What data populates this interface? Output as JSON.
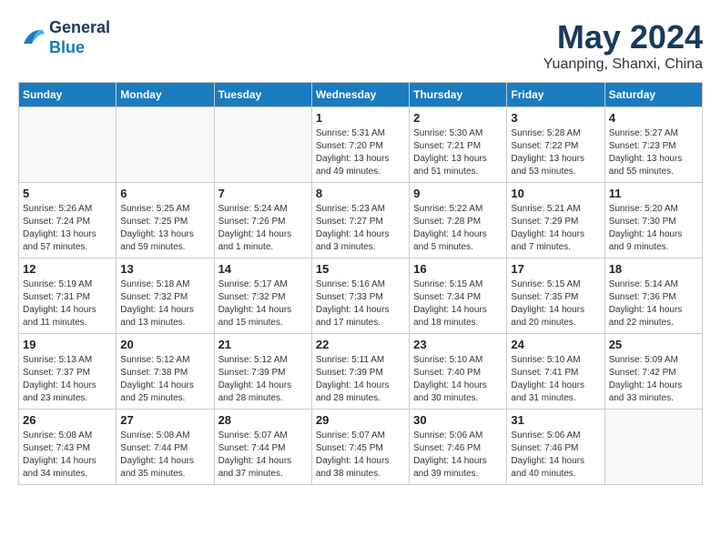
{
  "header": {
    "logo_line1": "General",
    "logo_line2": "Blue",
    "month_year": "May 2024",
    "location": "Yuanping, Shanxi, China"
  },
  "weekdays": [
    "Sunday",
    "Monday",
    "Tuesday",
    "Wednesday",
    "Thursday",
    "Friday",
    "Saturday"
  ],
  "weeks": [
    [
      {
        "day": "",
        "info": ""
      },
      {
        "day": "",
        "info": ""
      },
      {
        "day": "",
        "info": ""
      },
      {
        "day": "1",
        "info": "Sunrise: 5:31 AM\nSunset: 7:20 PM\nDaylight: 13 hours\nand 49 minutes."
      },
      {
        "day": "2",
        "info": "Sunrise: 5:30 AM\nSunset: 7:21 PM\nDaylight: 13 hours\nand 51 minutes."
      },
      {
        "day": "3",
        "info": "Sunrise: 5:28 AM\nSunset: 7:22 PM\nDaylight: 13 hours\nand 53 minutes."
      },
      {
        "day": "4",
        "info": "Sunrise: 5:27 AM\nSunset: 7:23 PM\nDaylight: 13 hours\nand 55 minutes."
      }
    ],
    [
      {
        "day": "5",
        "info": "Sunrise: 5:26 AM\nSunset: 7:24 PM\nDaylight: 13 hours\nand 57 minutes."
      },
      {
        "day": "6",
        "info": "Sunrise: 5:25 AM\nSunset: 7:25 PM\nDaylight: 13 hours\nand 59 minutes."
      },
      {
        "day": "7",
        "info": "Sunrise: 5:24 AM\nSunset: 7:26 PM\nDaylight: 14 hours\nand 1 minute."
      },
      {
        "day": "8",
        "info": "Sunrise: 5:23 AM\nSunset: 7:27 PM\nDaylight: 14 hours\nand 3 minutes."
      },
      {
        "day": "9",
        "info": "Sunrise: 5:22 AM\nSunset: 7:28 PM\nDaylight: 14 hours\nand 5 minutes."
      },
      {
        "day": "10",
        "info": "Sunrise: 5:21 AM\nSunset: 7:29 PM\nDaylight: 14 hours\nand 7 minutes."
      },
      {
        "day": "11",
        "info": "Sunrise: 5:20 AM\nSunset: 7:30 PM\nDaylight: 14 hours\nand 9 minutes."
      }
    ],
    [
      {
        "day": "12",
        "info": "Sunrise: 5:19 AM\nSunset: 7:31 PM\nDaylight: 14 hours\nand 11 minutes."
      },
      {
        "day": "13",
        "info": "Sunrise: 5:18 AM\nSunset: 7:32 PM\nDaylight: 14 hours\nand 13 minutes."
      },
      {
        "day": "14",
        "info": "Sunrise: 5:17 AM\nSunset: 7:32 PM\nDaylight: 14 hours\nand 15 minutes."
      },
      {
        "day": "15",
        "info": "Sunrise: 5:16 AM\nSunset: 7:33 PM\nDaylight: 14 hours\nand 17 minutes."
      },
      {
        "day": "16",
        "info": "Sunrise: 5:15 AM\nSunset: 7:34 PM\nDaylight: 14 hours\nand 18 minutes."
      },
      {
        "day": "17",
        "info": "Sunrise: 5:15 AM\nSunset: 7:35 PM\nDaylight: 14 hours\nand 20 minutes."
      },
      {
        "day": "18",
        "info": "Sunrise: 5:14 AM\nSunset: 7:36 PM\nDaylight: 14 hours\nand 22 minutes."
      }
    ],
    [
      {
        "day": "19",
        "info": "Sunrise: 5:13 AM\nSunset: 7:37 PM\nDaylight: 14 hours\nand 23 minutes."
      },
      {
        "day": "20",
        "info": "Sunrise: 5:12 AM\nSunset: 7:38 PM\nDaylight: 14 hours\nand 25 minutes."
      },
      {
        "day": "21",
        "info": "Sunrise: 5:12 AM\nSunset: 7:39 PM\nDaylight: 14 hours\nand 28 minutes."
      },
      {
        "day": "22",
        "info": "Sunrise: 5:11 AM\nSunset: 7:39 PM\nDaylight: 14 hours\nand 28 minutes."
      },
      {
        "day": "23",
        "info": "Sunrise: 5:10 AM\nSunset: 7:40 PM\nDaylight: 14 hours\nand 30 minutes."
      },
      {
        "day": "24",
        "info": "Sunrise: 5:10 AM\nSunset: 7:41 PM\nDaylight: 14 hours\nand 31 minutes."
      },
      {
        "day": "25",
        "info": "Sunrise: 5:09 AM\nSunset: 7:42 PM\nDaylight: 14 hours\nand 33 minutes."
      }
    ],
    [
      {
        "day": "26",
        "info": "Sunrise: 5:08 AM\nSunset: 7:43 PM\nDaylight: 14 hours\nand 34 minutes."
      },
      {
        "day": "27",
        "info": "Sunrise: 5:08 AM\nSunset: 7:44 PM\nDaylight: 14 hours\nand 35 minutes."
      },
      {
        "day": "28",
        "info": "Sunrise: 5:07 AM\nSunset: 7:44 PM\nDaylight: 14 hours\nand 37 minutes."
      },
      {
        "day": "29",
        "info": "Sunrise: 5:07 AM\nSunset: 7:45 PM\nDaylight: 14 hours\nand 38 minutes."
      },
      {
        "day": "30",
        "info": "Sunrise: 5:06 AM\nSunset: 7:46 PM\nDaylight: 14 hours\nand 39 minutes."
      },
      {
        "day": "31",
        "info": "Sunrise: 5:06 AM\nSunset: 7:46 PM\nDaylight: 14 hours\nand 40 minutes."
      },
      {
        "day": "",
        "info": ""
      }
    ]
  ]
}
